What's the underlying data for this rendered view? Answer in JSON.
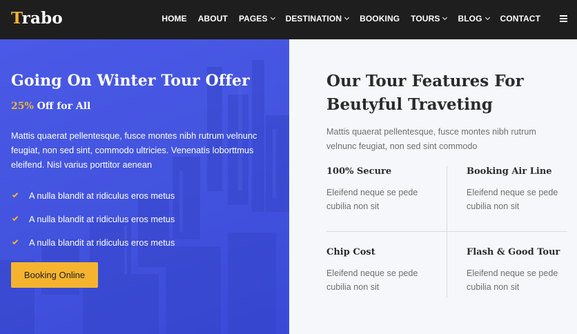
{
  "brand": {
    "logo_first": "T",
    "logo_rest": "rabo",
    "accent": "#f6b42e"
  },
  "nav": {
    "items": [
      {
        "label": "HOME"
      },
      {
        "label": "ABOUT"
      },
      {
        "label": "PAGES"
      },
      {
        "label": "DESTINATION"
      },
      {
        "label": "BOOKING"
      },
      {
        "label": "TOURS"
      },
      {
        "label": "BLOG"
      },
      {
        "label": "CONTACT"
      }
    ],
    "menu_icon": "hamburger-icon"
  },
  "hero": {
    "title": "Going On Winter Tour Offer",
    "offer_percent": "25%",
    "offer_text": "Off for All",
    "description": "Mattis quaerat pellentesque, fusce montes nibh rutrum velnunc feugiat, non sed sint, commodo ultricies. Venenatis loborttmus eleifend. Nisl varius porttitor aenean",
    "checks": [
      "A nulla blandit at ridiculus eros metus",
      "A nulla blandit at ridiculus eros metus",
      "A nulla blandit at ridiculus eros metus"
    ],
    "button_label": "Booking Online",
    "background": "#4253de"
  },
  "features": {
    "title": "Our Tour Features For Beutyful Traveting",
    "description": "Mattis quaerat pellentesque, fusce montes nibh rutrum velnunc feugiat, non sed sint commodo",
    "items": [
      {
        "title": "100% Secure",
        "text": "Eleifend neque se pede cubilia non sit"
      },
      {
        "title": "Booking Air Line",
        "text": "Eleifend neque se pede cubilia non sit"
      },
      {
        "title": "Chip Cost",
        "text": "Eleifend neque se pede cubilia non sit"
      },
      {
        "title": "Flash & Good Tour",
        "text": "Eleifend neque se pede cubilia non sit"
      }
    ]
  }
}
